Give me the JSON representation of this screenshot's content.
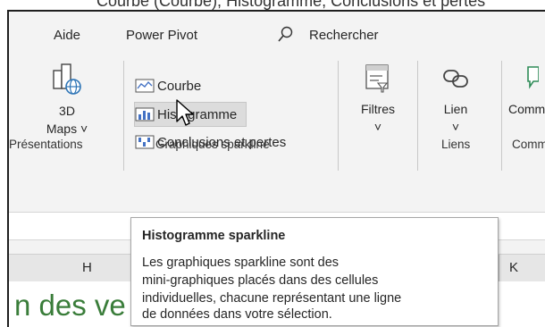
{
  "top_cut_text": "Courbe (Courbe), Histogramme, Conclusions et pertes",
  "menu": {
    "help": "Aide",
    "power_pivot": "Power Pivot",
    "search": "Rechercher"
  },
  "ribbon": {
    "maps": {
      "line1": "3D",
      "line2": "Maps ˅"
    },
    "presentations_label": "Présentations",
    "sparkline": {
      "line": "Courbe",
      "column": "Histogramme",
      "winloss": "Conclusions et pertes",
      "group_label": "Graphiques sparkline"
    },
    "filters": {
      "label": "Filtres",
      "arrow": "˅"
    },
    "link": {
      "label": "Lien",
      "arrow": "˅"
    },
    "links_group_label": "Liens",
    "comments": {
      "label": "Comm",
      "group_label": "Comm"
    }
  },
  "columns": {
    "h": "H",
    "k": "K"
  },
  "sheet_text": "n des ve",
  "tooltip": {
    "title": "Histogramme sparkline",
    "lines": [
      "Les graphiques sparkline sont des",
      "mini-graphiques placés dans des cellules",
      "individuelles, chacune représentant une ligne",
      "de données dans votre sélection."
    ]
  },
  "colors": {
    "accent": "#4472c4",
    "sheet_text": "#3a7d3a",
    "ribbon_bg": "#f3f3f3",
    "hover": "#dcdcdc"
  }
}
